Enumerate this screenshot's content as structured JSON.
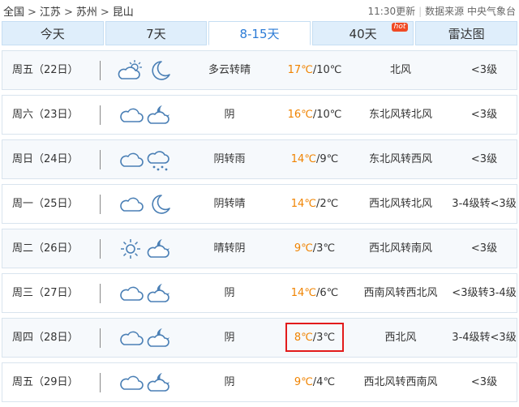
{
  "breadcrumb": {
    "items": [
      "全国",
      "江苏",
      "苏州",
      "昆山"
    ],
    "sep": ">"
  },
  "meta": {
    "updated": "11:30更新",
    "source": "数据来源 中央气象台"
  },
  "tabs": [
    {
      "label": "今天",
      "active": false
    },
    {
      "label": "7天",
      "active": false
    },
    {
      "label": "8-15天",
      "active": true
    },
    {
      "label": "40天",
      "active": false,
      "badge": "hot"
    },
    {
      "label": "雷达图",
      "active": false
    }
  ],
  "forecast": [
    {
      "date": "周五（22日）",
      "icons": [
        "cloud-sun-icon",
        "moon-icon"
      ],
      "desc": "多云转晴",
      "high": "17℃",
      "low": "/10℃",
      "wind": "北风",
      "level": "<3级"
    },
    {
      "date": "周六（23日）",
      "icons": [
        "cloud-icon",
        "cloud-moon-icon"
      ],
      "desc": "阴",
      "high": "16℃",
      "low": "/10℃",
      "wind": "东北风转北风",
      "level": "<3级"
    },
    {
      "date": "周日（24日）",
      "icons": [
        "cloud-icon",
        "cloud-rain-icon"
      ],
      "desc": "阴转雨",
      "high": "14℃",
      "low": "/9℃",
      "wind": "东北风转西风",
      "level": "<3级"
    },
    {
      "date": "周一（25日）",
      "icons": [
        "cloud-icon",
        "moon-icon"
      ],
      "desc": "阴转晴",
      "high": "14℃",
      "low": "/2℃",
      "wind": "西北风转北风",
      "level": "3-4级转<3级"
    },
    {
      "date": "周二（26日）",
      "icons": [
        "sun-icon",
        "cloud-moon-icon"
      ],
      "desc": "晴转阴",
      "high": "9℃",
      "low": "/3℃",
      "wind": "西北风转南风",
      "level": "<3级"
    },
    {
      "date": "周三（27日）",
      "icons": [
        "cloud-icon",
        "cloud-moon-icon"
      ],
      "desc": "阴",
      "high": "14℃",
      "low": "/6℃",
      "wind": "西南风转西北风",
      "level": "<3级转3-4级"
    },
    {
      "date": "周四（28日）",
      "icons": [
        "cloud-icon",
        "cloud-moon-icon"
      ],
      "desc": "阴",
      "high": "8℃",
      "low": "/3℃",
      "wind": "西北风",
      "level": "3-4级转<3级"
    },
    {
      "date": "周五（29日）",
      "icons": [
        "cloud-icon",
        "cloud-moon-icon"
      ],
      "desc": "阴",
      "high": "9℃",
      "low": "/4℃",
      "wind": "西北风转西南风",
      "level": "<3级"
    }
  ],
  "colors": {
    "high_temp": "#f08300",
    "tab_active": "#2b7bd6",
    "tab_bg": "#dfeefb",
    "highlight": "#e21b1b"
  }
}
